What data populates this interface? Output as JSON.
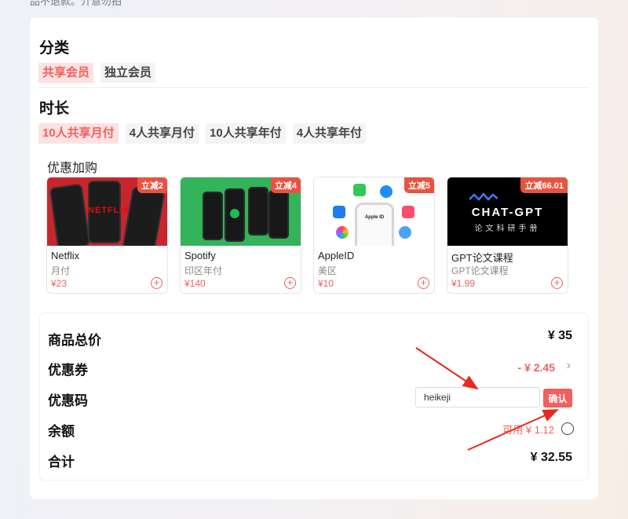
{
  "page_note": "品不退款。介意勿拍",
  "category": {
    "title": "分类",
    "options": [
      {
        "label": "共享会员",
        "active": true
      },
      {
        "label": "独立会员",
        "active": false
      }
    ]
  },
  "duration": {
    "title": "时长",
    "options": [
      {
        "label": "10人共享月付",
        "active": true
      },
      {
        "label": "4人共享月付",
        "active": false
      },
      {
        "label": "10人共享年付",
        "active": false
      },
      {
        "label": "4人共享年付",
        "active": false
      }
    ]
  },
  "addons": {
    "title": "优惠加购",
    "items": [
      {
        "name": "Netflix",
        "sub": "月付",
        "price": "¥23",
        "badge": "立减2",
        "thumb_logo": "NETFLIX",
        "add_icon": "plus-circle-icon"
      },
      {
        "name": "Spotify",
        "sub": "印区年付",
        "price": "¥140",
        "badge": "立减4",
        "add_icon": "plus-circle-icon"
      },
      {
        "name": "AppleID",
        "sub": "美区",
        "price": "¥10",
        "badge": "立减5",
        "thumb_text": "Apple ID",
        "add_icon": "plus-circle-icon"
      },
      {
        "name": "GPT论文课程",
        "sub": "GPT论文课程",
        "price": "¥1.99",
        "badge": "立减66.01",
        "thumb_title": "CHAT-GPT",
        "thumb_sub": "论文科研手册",
        "add_icon": "plus-circle-icon"
      }
    ]
  },
  "summary": {
    "total_label": "商品总价",
    "total_value": "¥ 35",
    "coupon_label": "优惠券",
    "coupon_value": "- ¥ 2.45",
    "code_label": "优惠码",
    "code_value": "heikeji",
    "confirm_label": "确认",
    "balance_label": "余额",
    "balance_text": "可用 ¥ 1.12",
    "sum_label": "合计",
    "sum_value": "¥ 32.55"
  },
  "colors": {
    "accent": "#f25f5c",
    "badge": "#e8533f",
    "annotation_arrow": "#e8281e"
  }
}
